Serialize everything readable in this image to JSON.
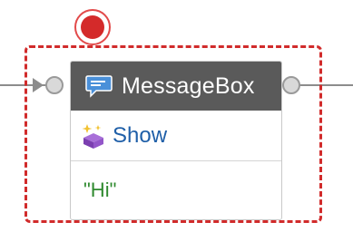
{
  "activity": {
    "title": "MessageBox",
    "method": "Show",
    "argument": "\"Hi\""
  },
  "icons": {
    "header": "speech-bubble-icon",
    "method": "method-sparkle-cube-icon"
  },
  "colors": {
    "header_bg": "#5a5a5a",
    "selection_border": "#d12b2b",
    "breakpoint": "#d42a2a",
    "method_text": "#1f5fa8",
    "argument_text": "#2f8a2f"
  }
}
